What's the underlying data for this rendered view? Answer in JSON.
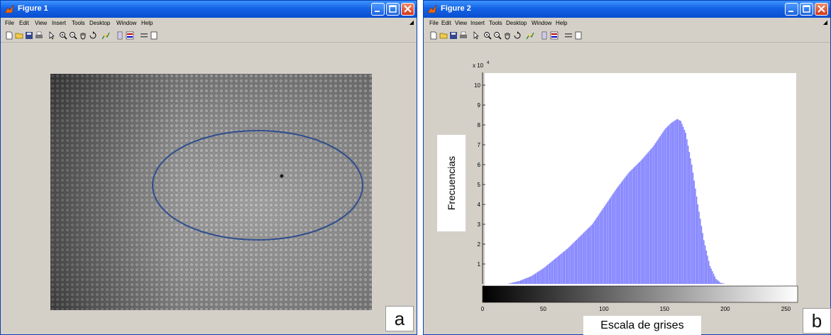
{
  "windows": [
    {
      "title": "Figure 1",
      "menu": [
        "File",
        "Edit",
        "View",
        "Insert",
        "Tools",
        "Desktop",
        "Window",
        "Help"
      ],
      "panel_letter": "a"
    },
    {
      "title": "Figure 2",
      "menu": [
        "File",
        "Edit",
        "View",
        "Insert",
        "Tools",
        "Desktop",
        "Window",
        "Help"
      ],
      "panel_letter": "b"
    }
  ],
  "toolbar_icons": [
    "new-file-icon",
    "open-folder-icon",
    "save-icon",
    "print-icon",
    "pointer-icon",
    "zoom-in-icon",
    "zoom-out-icon",
    "pan-icon",
    "rotate-icon",
    "data-cursor-icon",
    "colorbar-icon",
    "legend-icon",
    "hide-plot-tools-icon",
    "show-plot-tools-icon"
  ],
  "annotation": {
    "shape": "ellipse",
    "color": "#2f4e8f"
  },
  "chart_data": {
    "type": "bar",
    "xlabel": "Escala de grises",
    "ylabel": "Frecuencias",
    "exponent_label": "x 10",
    "exponent_power": "4",
    "xlim": [
      0,
      255
    ],
    "ylim": [
      0,
      10.5
    ],
    "xticks": [
      0,
      50,
      100,
      150,
      200,
      250
    ],
    "yticks": [
      1,
      2,
      3,
      4,
      5,
      6,
      7,
      8,
      9,
      10
    ],
    "bar_color": "#8080ff",
    "colorbar": "grayscale",
    "profile": [
      [
        0,
        0
      ],
      [
        20,
        0
      ],
      [
        30,
        0.15
      ],
      [
        40,
        0.4
      ],
      [
        50,
        0.8
      ],
      [
        60,
        1.3
      ],
      [
        70,
        1.8
      ],
      [
        80,
        2.4
      ],
      [
        90,
        3.0
      ],
      [
        100,
        3.9
      ],
      [
        110,
        4.8
      ],
      [
        120,
        5.6
      ],
      [
        130,
        6.2
      ],
      [
        140,
        6.9
      ],
      [
        150,
        7.8
      ],
      [
        155,
        8.1
      ],
      [
        160,
        8.3
      ],
      [
        163,
        8.2
      ],
      [
        167,
        7.6
      ],
      [
        172,
        6.0
      ],
      [
        177,
        4.0
      ],
      [
        182,
        2.2
      ],
      [
        187,
        0.9
      ],
      [
        192,
        0.25
      ],
      [
        196,
        0.05
      ],
      [
        200,
        0
      ],
      [
        255,
        0
      ]
    ]
  }
}
